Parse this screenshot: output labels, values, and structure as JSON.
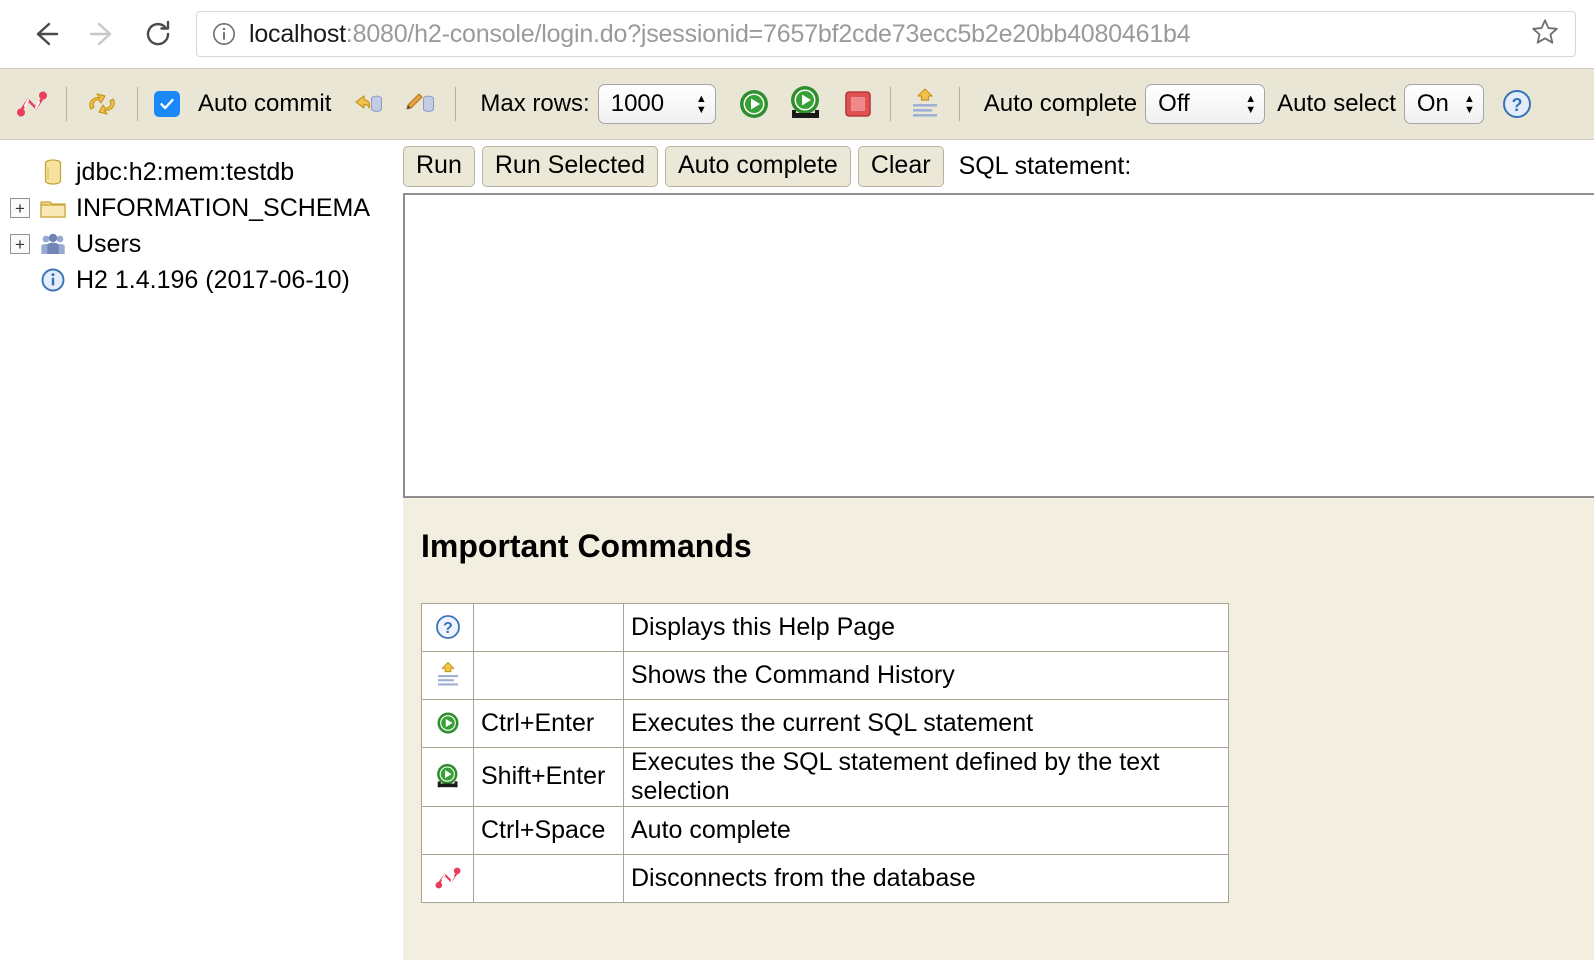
{
  "browser": {
    "back_label": "Back",
    "forward_label": "Forward",
    "reload_label": "Reload",
    "url_host": "localhost",
    "url_rest": ":8080/h2-console/login.do?jsessionid=7657bf2cde73ecc5b2e20bb4080461b4",
    "bookmark_label": "Bookmark this page"
  },
  "toolbar": {
    "disconnect_label": "Disconnect",
    "refresh_label": "Refresh",
    "auto_commit_label": "Auto commit",
    "auto_commit_checked": true,
    "rollback_label": "Rollback",
    "commit_label": "Commit",
    "max_rows_label": "Max rows:",
    "max_rows_value": "1000",
    "run_label": "Run",
    "run_selected_label": "Run Selected",
    "stop_label": "Stop",
    "history_label": "Command History",
    "auto_complete_label": "Auto complete",
    "auto_complete_value": "Off",
    "auto_select_label": "Auto select",
    "auto_select_value": "On",
    "help_label": "Help"
  },
  "sidebar": {
    "items": [
      {
        "label": "jdbc:h2:mem:testdb",
        "icon": "database-icon",
        "expander": ""
      },
      {
        "label": "INFORMATION_SCHEMA",
        "icon": "folder-icon",
        "expander": "+"
      },
      {
        "label": "Users",
        "icon": "users-icon",
        "expander": "+"
      },
      {
        "label": "H2 1.4.196 (2017-06-10)",
        "icon": "info-icon",
        "expander": ""
      }
    ]
  },
  "command_bar": {
    "run_label": "Run",
    "run_selected_label": "Run Selected",
    "auto_complete_label": "Auto complete",
    "clear_label": "Clear",
    "sql_statement_label": "SQL statement:"
  },
  "editor": {
    "value": "",
    "placeholder": ""
  },
  "content": {
    "title": "Important Commands",
    "rows": [
      {
        "icon": "help-icon",
        "key": "",
        "desc": "Displays this Help Page"
      },
      {
        "icon": "history-icon",
        "key": "",
        "desc": "Shows the Command History"
      },
      {
        "icon": "run-icon",
        "key": "Ctrl+Enter",
        "desc": "Executes the current SQL statement"
      },
      {
        "icon": "run-selected-icon",
        "key": "Shift+Enter",
        "desc": "Executes the SQL statement defined by the text selection"
      },
      {
        "icon": "",
        "key": "Ctrl+Space",
        "desc": "Auto complete"
      },
      {
        "icon": "disconnect-icon",
        "key": "",
        "desc": "Disconnects from the database"
      }
    ]
  },
  "colors": {
    "toolbar_bg": "#e9e6d6",
    "content_bg": "#f2efe1",
    "button_bg": "#ece8d8",
    "accent_blue": "#1a88f7",
    "run_green": "#2f8f2f",
    "stop_red": "#e05252",
    "disconnect_red": "#e8405a"
  }
}
